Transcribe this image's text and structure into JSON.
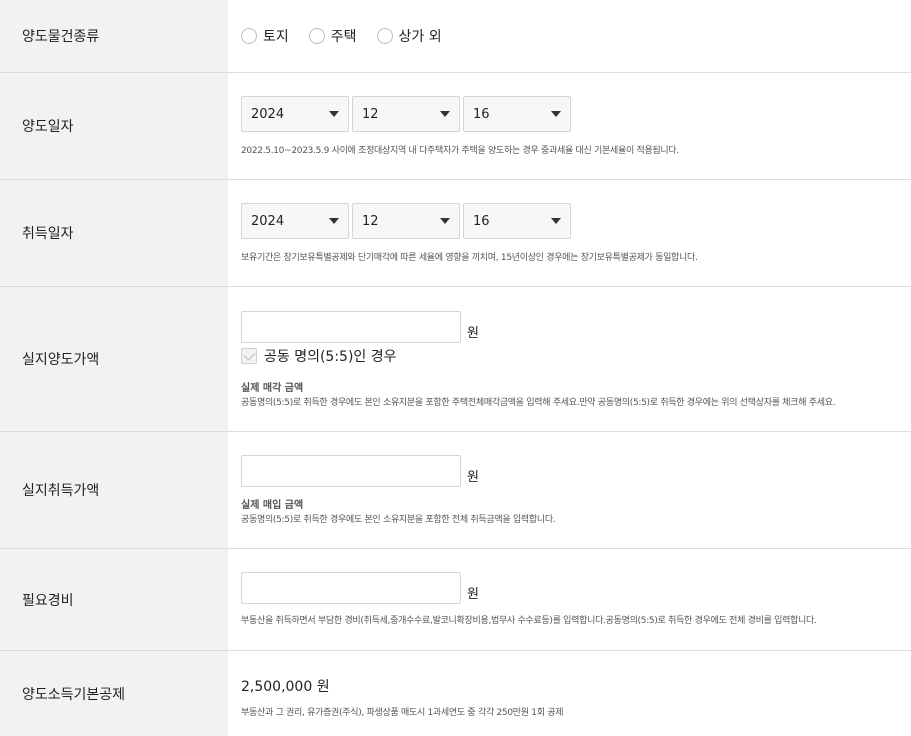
{
  "rows": {
    "property_type": {
      "label": "양도물건종류",
      "options": [
        "토지",
        "주택",
        "상가 외"
      ]
    },
    "transfer_date": {
      "label": "양도일자",
      "year": "2024",
      "month": "12",
      "day": "16",
      "note": "2022.5.10~2023.5.9 사이에 조정대상지역 내 다주택자가 주택을 양도하는 경우 중과세율 대신 기본세율이 적용됩니다."
    },
    "acquisition_date": {
      "label": "취득일자",
      "year": "2024",
      "month": "12",
      "day": "16",
      "note": "보유기간은 장기보유특별공제와 단기매각에 따른 세율에 영향을 끼치며, 15년이상인 경우에는 장기보유특별공제가 동일합니다."
    },
    "actual_transfer_price": {
      "label": "실지양도가액",
      "value": "",
      "unit": "원",
      "checkbox_label": "공동 명의(5:5)인 경우",
      "note_title": "실제 매각 금액",
      "note": "공동명의(5:5)로 취득한 경우에도 본인 소유지분을 포함한 주택전체매각금액을 입력해 주세요.만약 공동명의(5:5)로 취득한 경우에는 위의 선택상자를 체크해 주세요."
    },
    "actual_acquisition_price": {
      "label": "실지취득가액",
      "value": "",
      "unit": "원",
      "note_title": "실제 매입 금액",
      "note": "공동명의(5:5)로 취득한 경우에도 본인 소유지분을 포함한 전체 취득금액을 입력합니다."
    },
    "necessary_expenses": {
      "label": "필요경비",
      "value": "",
      "unit": "원",
      "note": "부동산을 취득하면서 부담한 경비(취득세,중개수수료,발코니확장비용,법무사 수수료등)를 입력합니다.공동명의(5:5)로 취득한 경우에도 전체 경비를 입력합니다."
    },
    "basic_deduction": {
      "label": "양도소득기본공제",
      "amount": "2,500,000 원",
      "note": "부동산과 그 권리, 유가증권(주식), 파생상품 매도시 1과세연도 중 각각 250만원 1회 공제"
    }
  }
}
